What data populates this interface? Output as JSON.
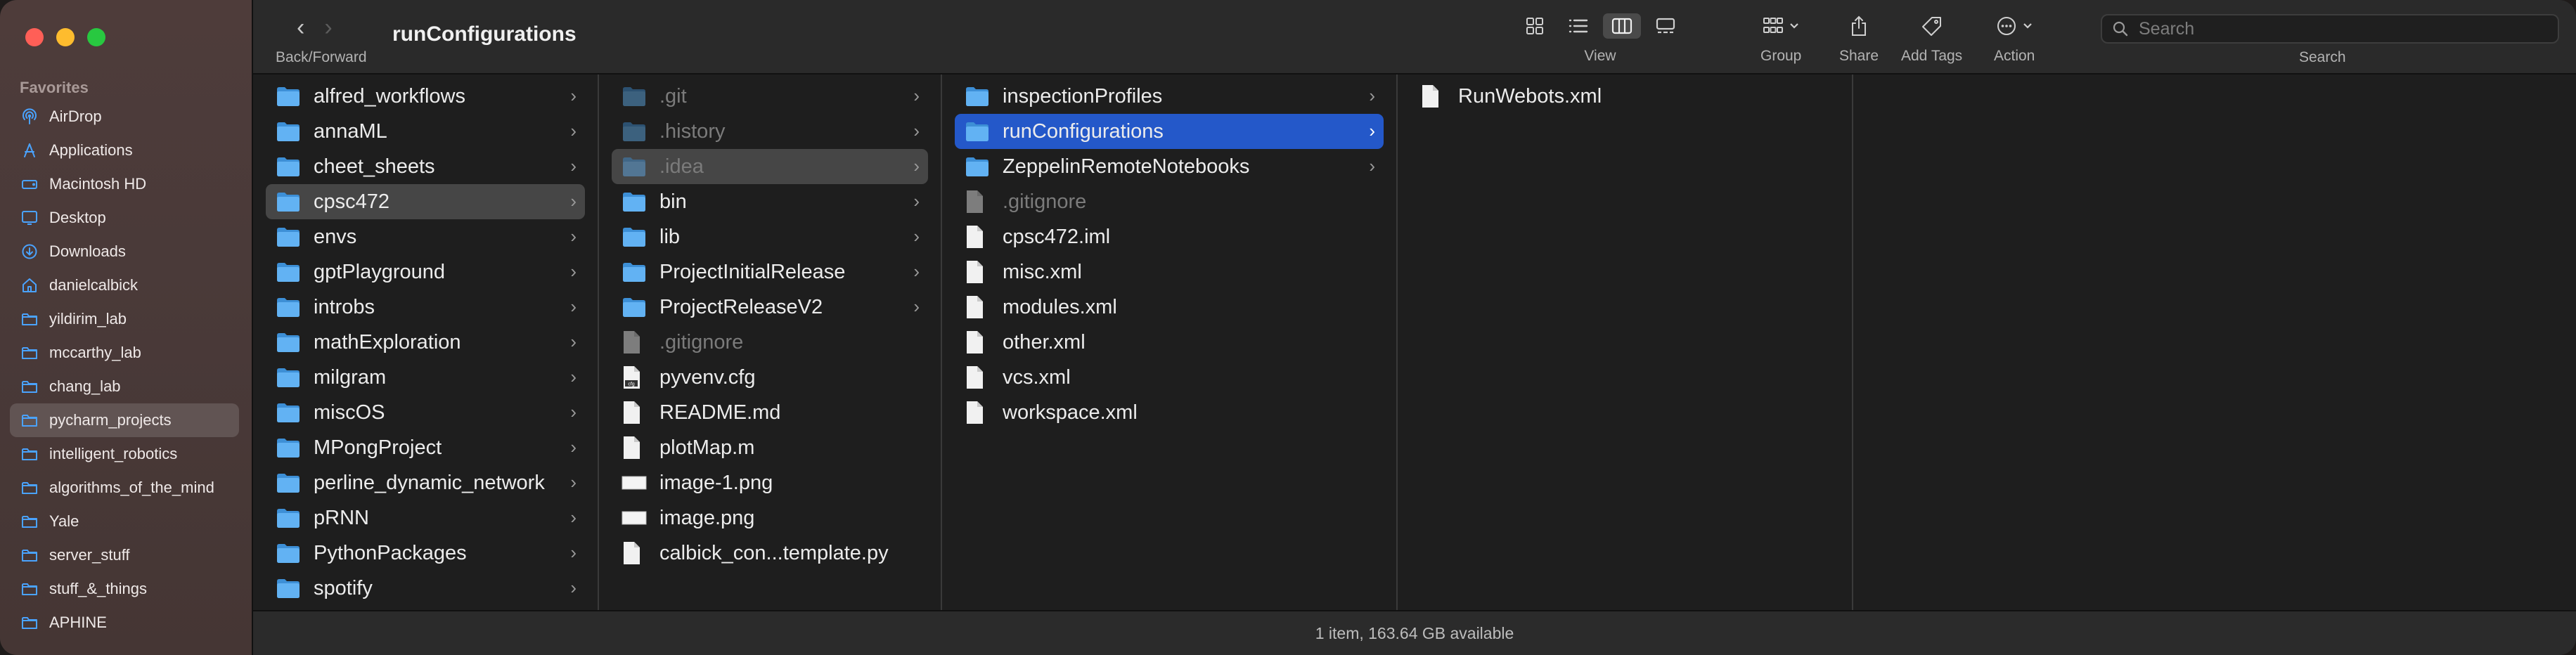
{
  "window": {
    "title": "runConfigurations"
  },
  "toolbar": {
    "back_forward_caption": "Back/Forward",
    "view_caption": "View",
    "group_caption": "Group",
    "share_caption": "Share",
    "add_tags_caption": "Add Tags",
    "action_caption": "Action",
    "search_caption": "Search",
    "search_placeholder": "Search"
  },
  "sidebar": {
    "section_label": "Favorites",
    "items": [
      {
        "label": "AirDrop",
        "icon": "airdrop-icon"
      },
      {
        "label": "Applications",
        "icon": "applications-icon"
      },
      {
        "label": "Macintosh HD",
        "icon": "hard-drive-icon"
      },
      {
        "label": "Desktop",
        "icon": "desktop-icon"
      },
      {
        "label": "Downloads",
        "icon": "downloads-icon"
      },
      {
        "label": "danielcalbick",
        "icon": "home-icon"
      },
      {
        "label": "yildirim_lab",
        "icon": "folder-icon"
      },
      {
        "label": "mccarthy_lab",
        "icon": "folder-icon"
      },
      {
        "label": "chang_lab",
        "icon": "folder-icon"
      },
      {
        "label": "pycharm_projects",
        "icon": "folder-icon",
        "selected": true
      },
      {
        "label": "intelligent_robotics",
        "icon": "folder-icon"
      },
      {
        "label": "algorithms_of_the_mind",
        "icon": "folder-icon"
      },
      {
        "label": "Yale",
        "icon": "folder-icon"
      },
      {
        "label": "server_stuff",
        "icon": "folder-icon"
      },
      {
        "label": "stuff_&_things",
        "icon": "folder-icon"
      },
      {
        "label": "APHINE",
        "icon": "folder-icon"
      }
    ]
  },
  "columns": {
    "col1": [
      {
        "name": "alfred_workflows",
        "type": "folder"
      },
      {
        "name": "annaML",
        "type": "folder"
      },
      {
        "name": "cheet_sheets",
        "type": "folder"
      },
      {
        "name": "cpsc472",
        "type": "folder",
        "selected": "grey"
      },
      {
        "name": "envs",
        "type": "folder"
      },
      {
        "name": "gptPlayground",
        "type": "folder"
      },
      {
        "name": "introbs",
        "type": "folder"
      },
      {
        "name": "mathExploration",
        "type": "folder"
      },
      {
        "name": "milgram",
        "type": "folder"
      },
      {
        "name": "miscOS",
        "type": "folder"
      },
      {
        "name": "MPongProject",
        "type": "folder"
      },
      {
        "name": "perline_dynamic_network",
        "type": "folder"
      },
      {
        "name": "pRNN",
        "type": "folder"
      },
      {
        "name": "PythonPackages",
        "type": "folder"
      },
      {
        "name": "spotify",
        "type": "folder"
      }
    ],
    "col2": [
      {
        "name": ".git",
        "type": "folder",
        "dim": true
      },
      {
        "name": ".history",
        "type": "folder",
        "dim": true
      },
      {
        "name": ".idea",
        "type": "folder",
        "dim": true,
        "selected": "grey"
      },
      {
        "name": "bin",
        "type": "folder"
      },
      {
        "name": "lib",
        "type": "folder"
      },
      {
        "name": "ProjectInitialRelease",
        "type": "folder"
      },
      {
        "name": "ProjectReleaseV2",
        "type": "folder"
      },
      {
        "name": ".gitignore",
        "type": "file",
        "dim": true
      },
      {
        "name": "pyvenv.cfg",
        "type": "cfg"
      },
      {
        "name": "README.md",
        "type": "file"
      },
      {
        "name": "plotMap.m",
        "type": "file"
      },
      {
        "name": "image-1.png",
        "type": "image"
      },
      {
        "name": "image.png",
        "type": "image"
      },
      {
        "name": "calbick_con...template.py",
        "type": "file"
      }
    ],
    "col3": [
      {
        "name": "inspectionProfiles",
        "type": "folder"
      },
      {
        "name": "runConfigurations",
        "type": "folder",
        "selected": "blue"
      },
      {
        "name": "ZeppelinRemoteNotebooks",
        "type": "folder"
      },
      {
        "name": ".gitignore",
        "type": "file",
        "dim": true
      },
      {
        "name": "cpsc472.iml",
        "type": "file"
      },
      {
        "name": "misc.xml",
        "type": "file"
      },
      {
        "name": "modules.xml",
        "type": "file"
      },
      {
        "name": "other.xml",
        "type": "file"
      },
      {
        "name": "vcs.xml",
        "type": "file"
      },
      {
        "name": "workspace.xml",
        "type": "file"
      }
    ],
    "col4": [
      {
        "name": "RunWebots.xml",
        "type": "file"
      }
    ]
  },
  "status_bar": {
    "text": "1 item, 163.64 GB available"
  },
  "colors": {
    "accent": "#2458c9",
    "folder": "#5aaef0"
  }
}
